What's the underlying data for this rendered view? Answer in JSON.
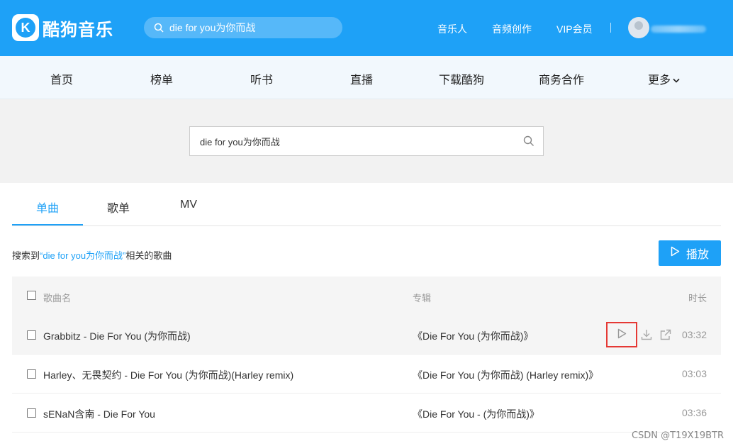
{
  "header": {
    "logo_letter": "K",
    "brand": "酷狗音乐",
    "search_value": "die for you为你而战",
    "links": [
      "音乐人",
      "音频创作",
      "VIP会员"
    ]
  },
  "nav": [
    "首页",
    "榜单",
    "听书",
    "直播",
    "下载酷狗",
    "商务合作",
    "更多"
  ],
  "search": {
    "value": "die for you为你而战"
  },
  "tabs": [
    "单曲",
    "歌单",
    "MV"
  ],
  "result": {
    "prefix": "搜索到",
    "keyword": "“die for you为你而战”",
    "suffix": "相关的歌曲"
  },
  "play_all_label": "播放",
  "table": {
    "headers": {
      "name": "歌曲名",
      "album": "专辑",
      "duration": "时长"
    },
    "rows": [
      {
        "name": "Grabbitz - Die For You (为你而战)",
        "album": "《Die For You (为你而战)》",
        "duration": "03:32"
      },
      {
        "name": "Harley、无畏契约 - Die For You (为你而战)(Harley remix)",
        "album": "《Die For You (为你而战) (Harley remix)》",
        "duration": "03:03"
      },
      {
        "name": "sENaN含南 - Die For You",
        "album": "《Die For You - (为你而战)》",
        "duration": "03:36"
      }
    ]
  },
  "watermark": "CSDN @T19X19BTR",
  "colors": {
    "brand_blue": "#1ea1f7",
    "highlight_red": "#e53935"
  }
}
